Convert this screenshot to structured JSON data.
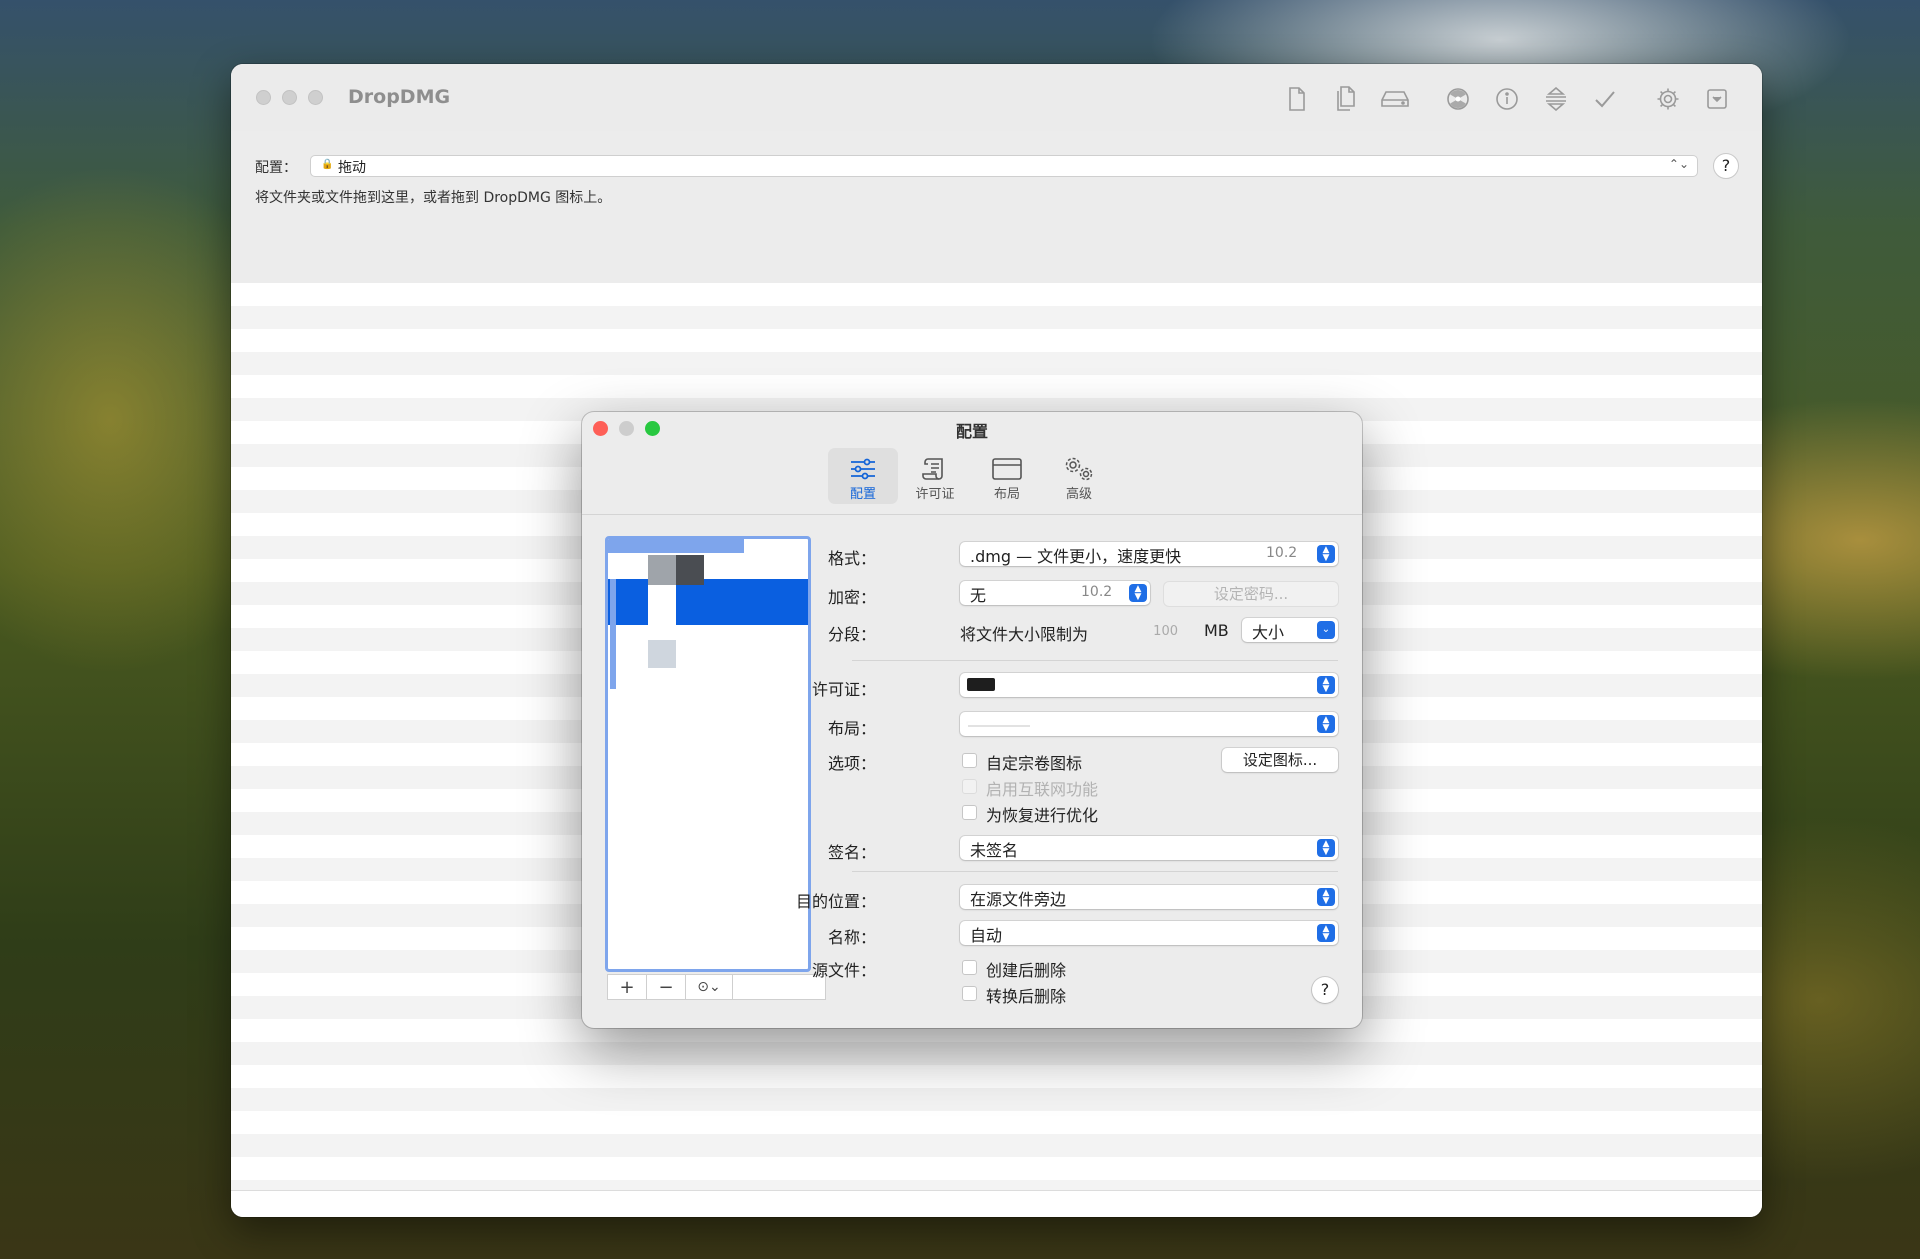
{
  "window": {
    "title": "DropDMG"
  },
  "toolbar_icons": [
    "new-document-icon",
    "copy-documents-icon",
    "drive-icon",
    "burn-icon",
    "info-icon",
    "compress-icon",
    "verify-check-icon",
    "gear-icon",
    "dropdown-box-icon"
  ],
  "config_bar": {
    "label": "配置：",
    "selected": "拖动",
    "hint": "将文件夹或文件拖到这里，或者拖到 DropDMG 图标上。",
    "help": "?"
  },
  "dialog": {
    "title": "配置",
    "tabs": [
      {
        "label": "配置",
        "active": true
      },
      {
        "label": "许可证",
        "active": false
      },
      {
        "label": "布局",
        "active": false
      },
      {
        "label": "高级",
        "active": false
      }
    ],
    "list_tools": {
      "add": "+",
      "remove": "−",
      "menu": "⊙⌄"
    },
    "format": {
      "label": "格式：",
      "value": ".dmg — 文件更小，速度更快",
      "version": "10.2"
    },
    "encryption": {
      "label": "加密：",
      "value": "无",
      "version": "10.2",
      "button": "设定密码..."
    },
    "segment": {
      "label": "分段：",
      "value": "将文件大小限制为",
      "size": "100",
      "unit": "MB",
      "mode": "大小"
    },
    "license": {
      "label": "许可证："
    },
    "layout": {
      "label": "布局："
    },
    "options": {
      "label": "选项：",
      "button": "设定图标...",
      "items": [
        {
          "label": "自定宗卷图标",
          "enabled": true
        },
        {
          "label": "启用互联网功能",
          "enabled": false
        },
        {
          "label": "为恢复进行优化",
          "enabled": true
        }
      ]
    },
    "signing": {
      "label": "签名：",
      "value": "未签名"
    },
    "destination": {
      "label": "目的位置：",
      "value": "在源文件旁边"
    },
    "name": {
      "label": "名称：",
      "value": "自动"
    },
    "source": {
      "label": "源文件：",
      "items": [
        {
          "label": "创建后删除"
        },
        {
          "label": "转换后删除"
        }
      ]
    },
    "help": "?"
  },
  "colors": {
    "accent": "#1f6ee6",
    "selection": "#0a5fe0",
    "close": "#fe5f57",
    "zoom": "#28c840"
  }
}
